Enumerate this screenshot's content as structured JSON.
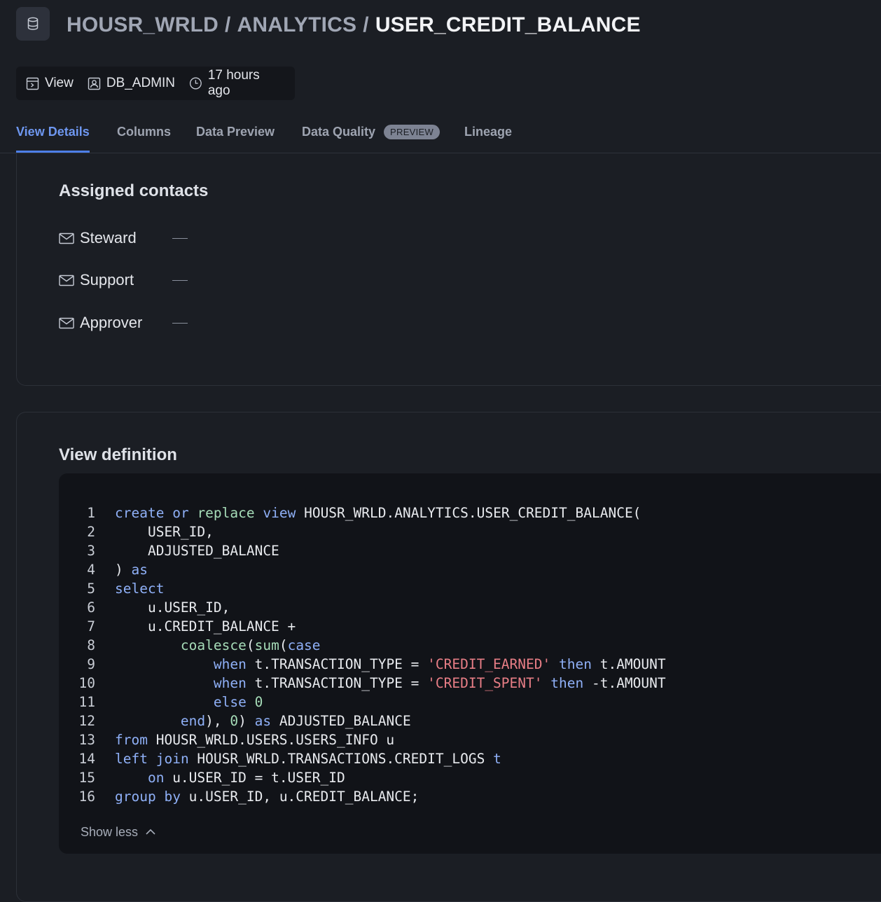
{
  "breadcrumb": {
    "database": "HOUSR_WRLD",
    "schema": "ANALYTICS",
    "object": "USER_CREDIT_BALANCE",
    "separator": "/"
  },
  "meta": {
    "type": "View",
    "owner": "DB_ADMIN",
    "updated": "17 hours ago"
  },
  "tabs": [
    {
      "label": "View Details",
      "active": true
    },
    {
      "label": "Columns"
    },
    {
      "label": "Data Preview"
    },
    {
      "label": "Data Quality",
      "badge": "PREVIEW"
    },
    {
      "label": "Lineage"
    }
  ],
  "contacts": {
    "title": "Assigned contacts",
    "items": [
      {
        "role": "Steward",
        "value": "—"
      },
      {
        "role": "Support",
        "value": "—"
      },
      {
        "role": "Approver",
        "value": "—"
      }
    ]
  },
  "definition": {
    "title": "View definition",
    "line_numbers": [
      "1",
      "2",
      "3",
      "4",
      "5",
      "6",
      "7",
      "8",
      "9",
      "10",
      "11",
      "12",
      "13",
      "14",
      "15",
      "16"
    ],
    "show_less_label": "Show less"
  },
  "colors": {
    "background": "#1b1e24",
    "accent": "#6e97f0",
    "keyword": "#8fb0f7",
    "function": "#a6dcb8",
    "string": "#e87e86"
  },
  "icons": {
    "header": "database-icon",
    "type": "view-icon",
    "owner": "user-badge-icon",
    "time": "clock-icon",
    "contact": "mail-icon",
    "collapse": "chevron-up-icon"
  }
}
